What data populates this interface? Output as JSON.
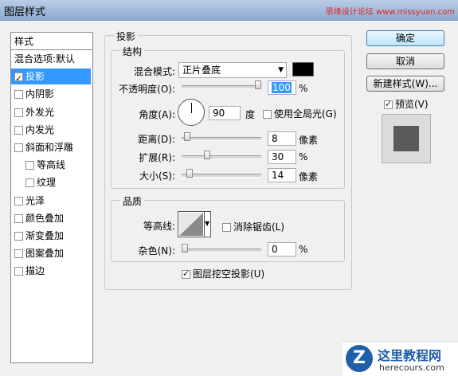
{
  "window": {
    "title": "图层样式",
    "watermark": "思缘设计论坛 www.missyuan.com"
  },
  "sidebar": {
    "header": "样式",
    "items": [
      {
        "label": "混合选项:默认",
        "checkbox": false,
        "checked": false,
        "selected": false
      },
      {
        "label": "投影",
        "checkbox": true,
        "checked": true,
        "selected": true
      },
      {
        "label": "内阴影",
        "checkbox": true,
        "checked": false,
        "selected": false
      },
      {
        "label": "外发光",
        "checkbox": true,
        "checked": false,
        "selected": false
      },
      {
        "label": "内发光",
        "checkbox": true,
        "checked": false,
        "selected": false
      },
      {
        "label": "斜面和浮雕",
        "checkbox": true,
        "checked": false,
        "selected": false
      },
      {
        "label": "等高线",
        "checkbox": true,
        "checked": false,
        "selected": false,
        "indent": true
      },
      {
        "label": "纹理",
        "checkbox": true,
        "checked": false,
        "selected": false,
        "indent": true
      },
      {
        "label": "光泽",
        "checkbox": true,
        "checked": false,
        "selected": false
      },
      {
        "label": "颜色叠加",
        "checkbox": true,
        "checked": false,
        "selected": false
      },
      {
        "label": "渐变叠加",
        "checkbox": true,
        "checked": false,
        "selected": false
      },
      {
        "label": "图案叠加",
        "checkbox": true,
        "checked": false,
        "selected": false
      },
      {
        "label": "描边",
        "checkbox": true,
        "checked": false,
        "selected": false
      }
    ]
  },
  "main": {
    "section_title": "投影",
    "structure": {
      "title": "结构",
      "blend_mode_label": "混合模式:",
      "blend_mode_value": "正片叠底",
      "blend_color": "#000000",
      "opacity_label": "不透明度(O):",
      "opacity_value": "100",
      "opacity_unit": "%",
      "opacity_level": 1.0,
      "angle_label": "角度(A):",
      "angle_value": "90",
      "angle_unit": "度",
      "global_light_label": "使用全局光(G)",
      "global_light_checked": false,
      "distance_label": "距离(D):",
      "distance_value": "8",
      "distance_unit": "像素",
      "distance_level": 0.03,
      "spread_label": "扩展(R):",
      "spread_value": "30",
      "spread_unit": "%",
      "spread_level": 0.3,
      "size_label": "大小(S):",
      "size_value": "14",
      "size_unit": "像素",
      "size_level": 0.06
    },
    "quality": {
      "title": "品质",
      "contour_label": "等高线:",
      "antialias_label": "消除锯齿(L)",
      "antialias_checked": false,
      "noise_label": "杂色(N):",
      "noise_value": "0",
      "noise_unit": "%",
      "noise_level": 0.0
    },
    "knockout_label": "图层挖空投影(U)",
    "knockout_checked": true
  },
  "buttons": {
    "ok": "确定",
    "cancel": "取消",
    "new_style": "新建样式(W)...",
    "preview_label": "预览(V)",
    "preview_checked": true
  },
  "logo": {
    "text": "这里教程网",
    "url_text": "herecours.com"
  }
}
